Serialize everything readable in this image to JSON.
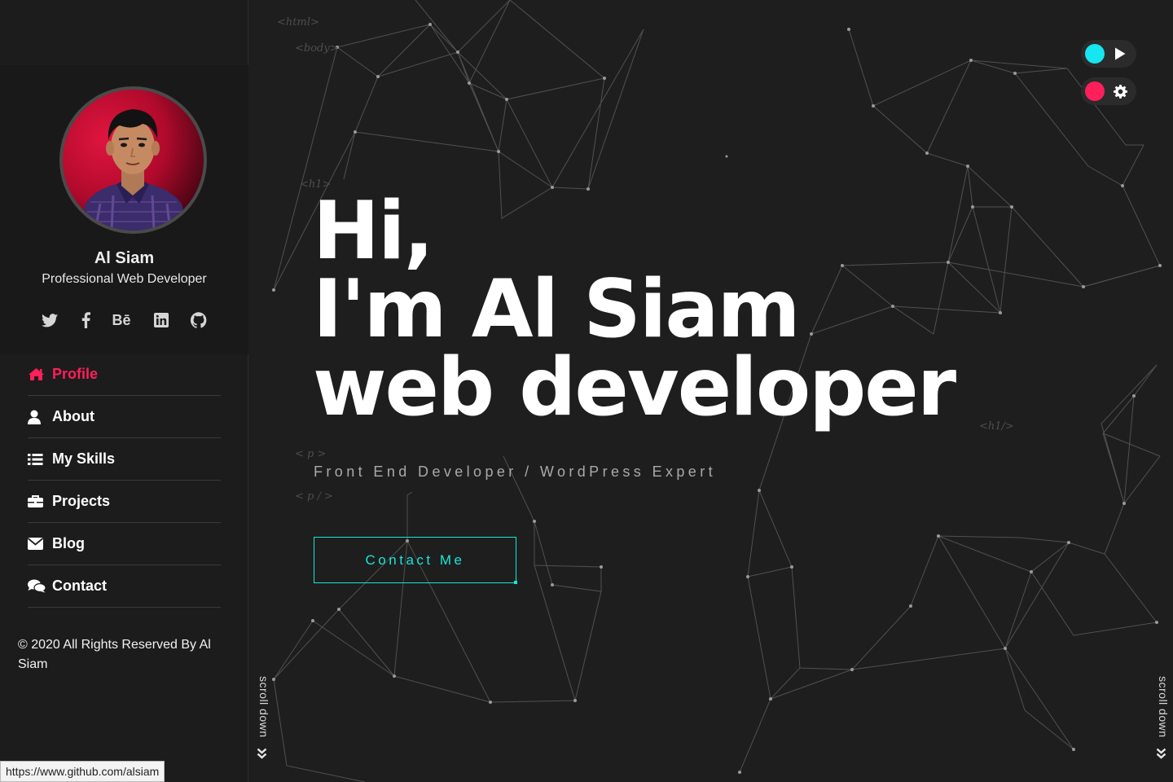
{
  "profile": {
    "name": "Al Siam",
    "role": "Professional Web Developer"
  },
  "socials": [
    "twitter-icon",
    "facebook-icon",
    "behance-icon",
    "linkedin-icon",
    "github-icon"
  ],
  "socials_behance_text": "Bē",
  "nav": {
    "items": [
      {
        "label": "Profile",
        "icon": "home-icon",
        "active": true
      },
      {
        "label": "About",
        "icon": "user-icon",
        "active": false
      },
      {
        "label": "My Skills",
        "icon": "list-icon",
        "active": false
      },
      {
        "label": "Projects",
        "icon": "briefcase-icon",
        "active": false
      },
      {
        "label": "Blog",
        "icon": "envelope-icon",
        "active": false
      },
      {
        "label": "Contact",
        "icon": "comments-icon",
        "active": false
      }
    ]
  },
  "copyright": "© 2020 All Rights Reserved By Al Siam",
  "status_url": "https://www.github.com/alsiam",
  "hero": {
    "line1": "Hi,",
    "line2": "I'm Al Siam",
    "line3": "web developer",
    "subtitle": "Front End Developer / WordPress Expert",
    "cta": "Contact Me"
  },
  "code_tags": {
    "html": "<html>",
    "body": "<body>",
    "h1_open": "<h1>",
    "h1_close": "<h1/>",
    "p_open": "< p >",
    "p_close": "< p / >"
  },
  "scroll_down": "scroll down",
  "toggles": {
    "play": {
      "icon": "play-icon",
      "color": "#16e6f0"
    },
    "settings": {
      "icon": "gear-icon",
      "color": "#ff1f5a"
    }
  },
  "colors": {
    "accent_pink": "#ff1f5a",
    "accent_cyan": "#17e6d6",
    "background": "#1e1e1e",
    "sidebar": "#1c1c1c"
  }
}
